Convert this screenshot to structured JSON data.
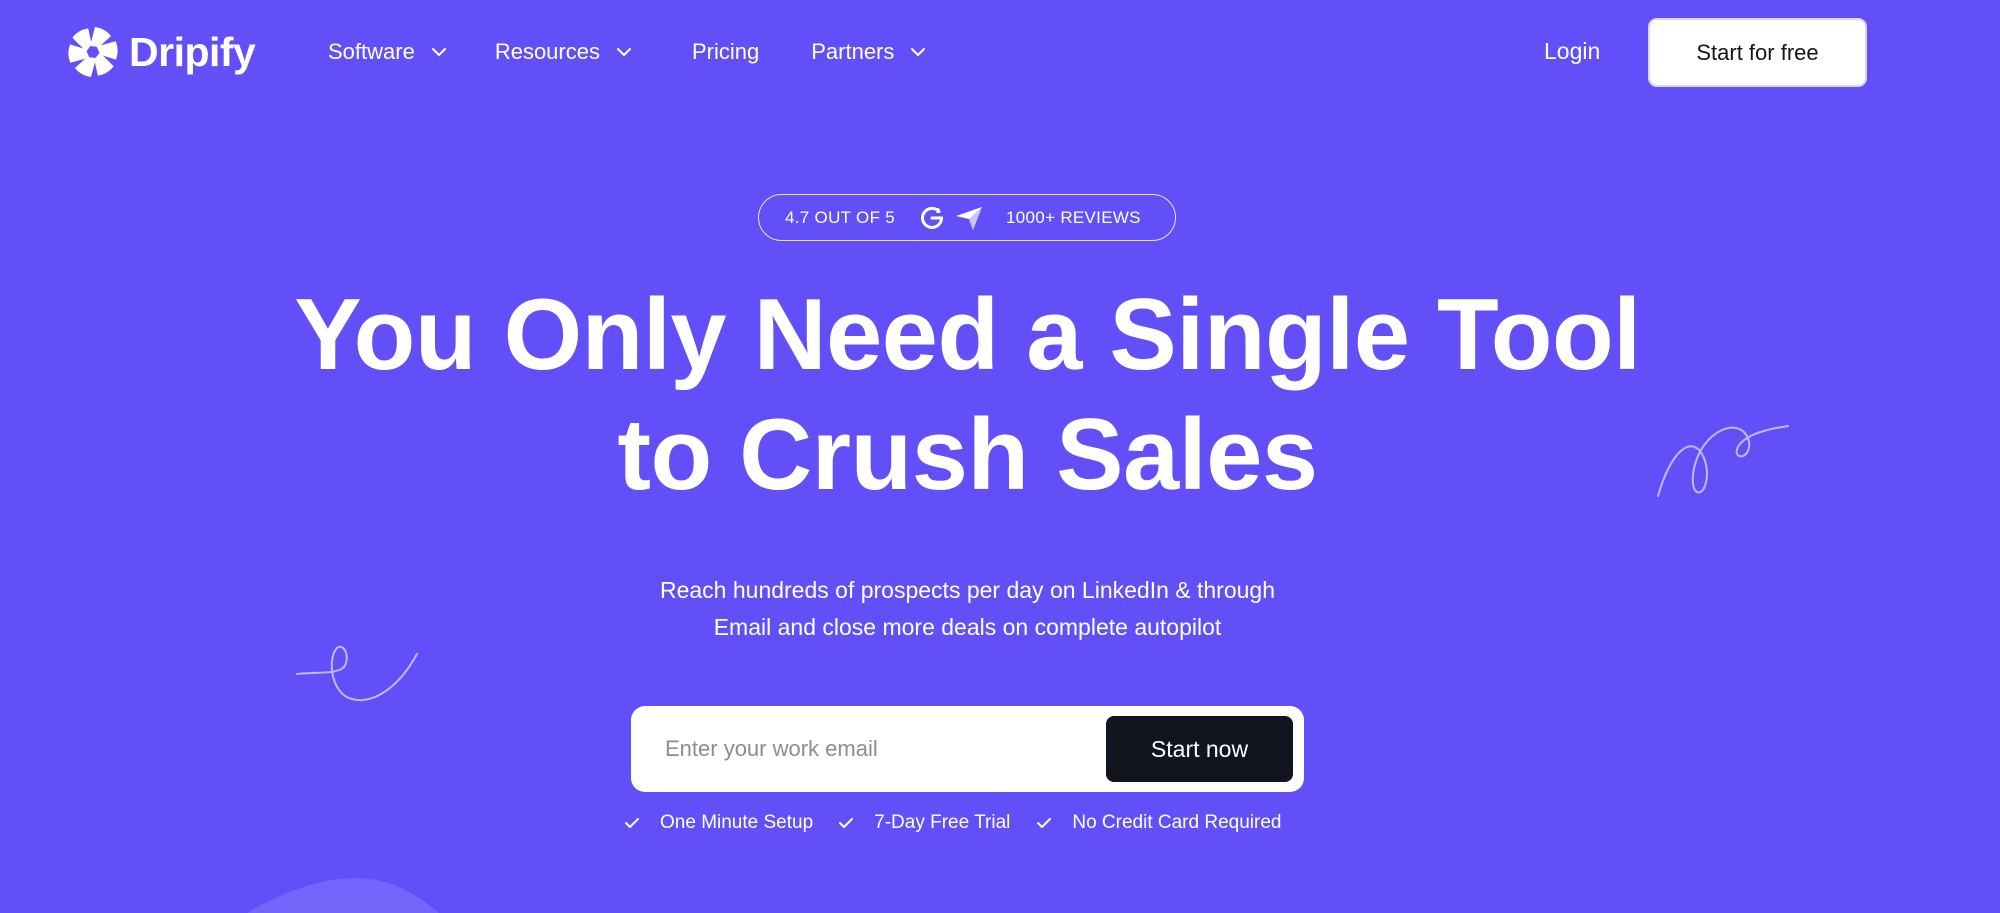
{
  "brand": {
    "name": "Dripify",
    "icon": "dripify-shutter-logo"
  },
  "nav": {
    "items": [
      {
        "label": "Software",
        "has_dropdown": true
      },
      {
        "label": "Resources",
        "has_dropdown": true
      },
      {
        "label": "Pricing",
        "has_dropdown": false
      },
      {
        "label": "Partners",
        "has_dropdown": true
      }
    ],
    "login_label": "Login",
    "cta_label": "Start for free"
  },
  "rating": {
    "score_text": "4.7 OUT OF 5",
    "reviews_text": "1000+ REVIEWS",
    "icons": [
      "g2-icon",
      "capterra-icon"
    ]
  },
  "hero": {
    "headline_line1": "You Only Need a Single Tool",
    "headline_line2": "to Crush Sales",
    "subtitle_line1": "Reach hundreds of prospects per day on LinkedIn & through",
    "subtitle_line2": "Email and close more deals on complete autopilot",
    "email_placeholder": "Enter your work email",
    "email_value": "",
    "submit_label": "Start now",
    "perks": [
      "One Minute Setup",
      "7-Day Free Trial",
      "No Credit Card Required"
    ]
  },
  "colors": {
    "background": "#634ff8",
    "text": "#ffffff",
    "dark_button": "#121420",
    "placeholder": "#8a8c98"
  }
}
